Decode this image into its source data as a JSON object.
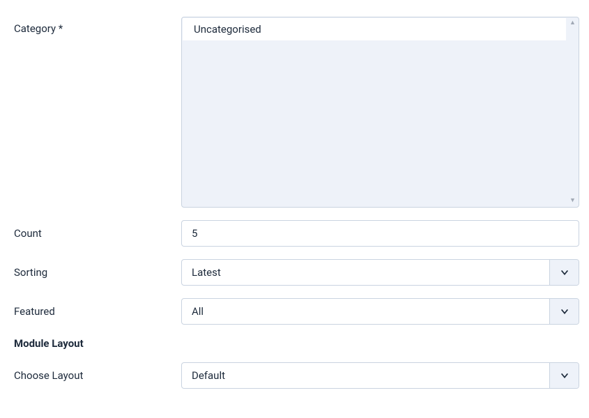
{
  "category": {
    "label": "Category *",
    "options": [
      {
        "text": "Uncategorised",
        "selected": true
      }
    ]
  },
  "count": {
    "label": "Count",
    "value": "5"
  },
  "sorting": {
    "label": "Sorting",
    "value": "Latest"
  },
  "featured": {
    "label": "Featured",
    "value": "All"
  },
  "module_layout_heading": "Module Layout",
  "choose_layout": {
    "label": "Choose Layout",
    "value": "Default"
  }
}
